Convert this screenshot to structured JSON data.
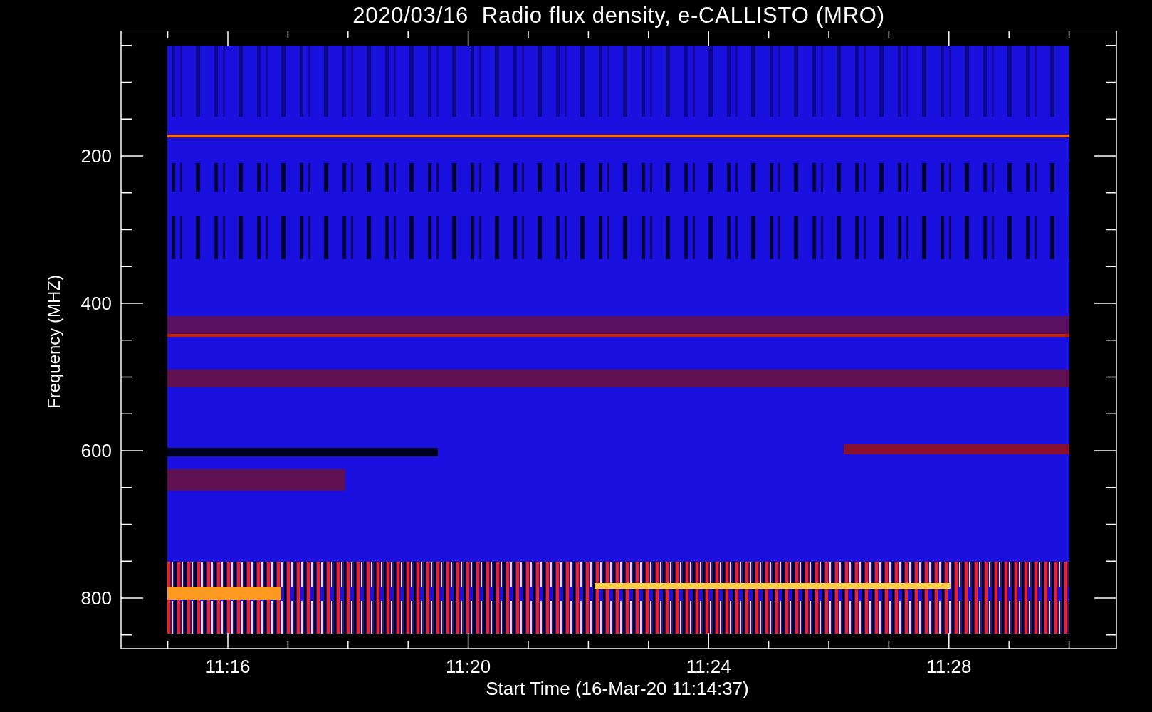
{
  "title": "2020/03/16  Radio flux density, e-CALLISTO (MRO)",
  "plot": {
    "ylabel": "Frequency (MHZ)",
    "xlabel": "Start Time (16-Mar-20 11:14:37)",
    "yticks": [
      "200",
      "400",
      "600",
      "800"
    ],
    "xticks": [
      "11:16",
      "11:20",
      "11:24",
      "11:28"
    ]
  }
}
